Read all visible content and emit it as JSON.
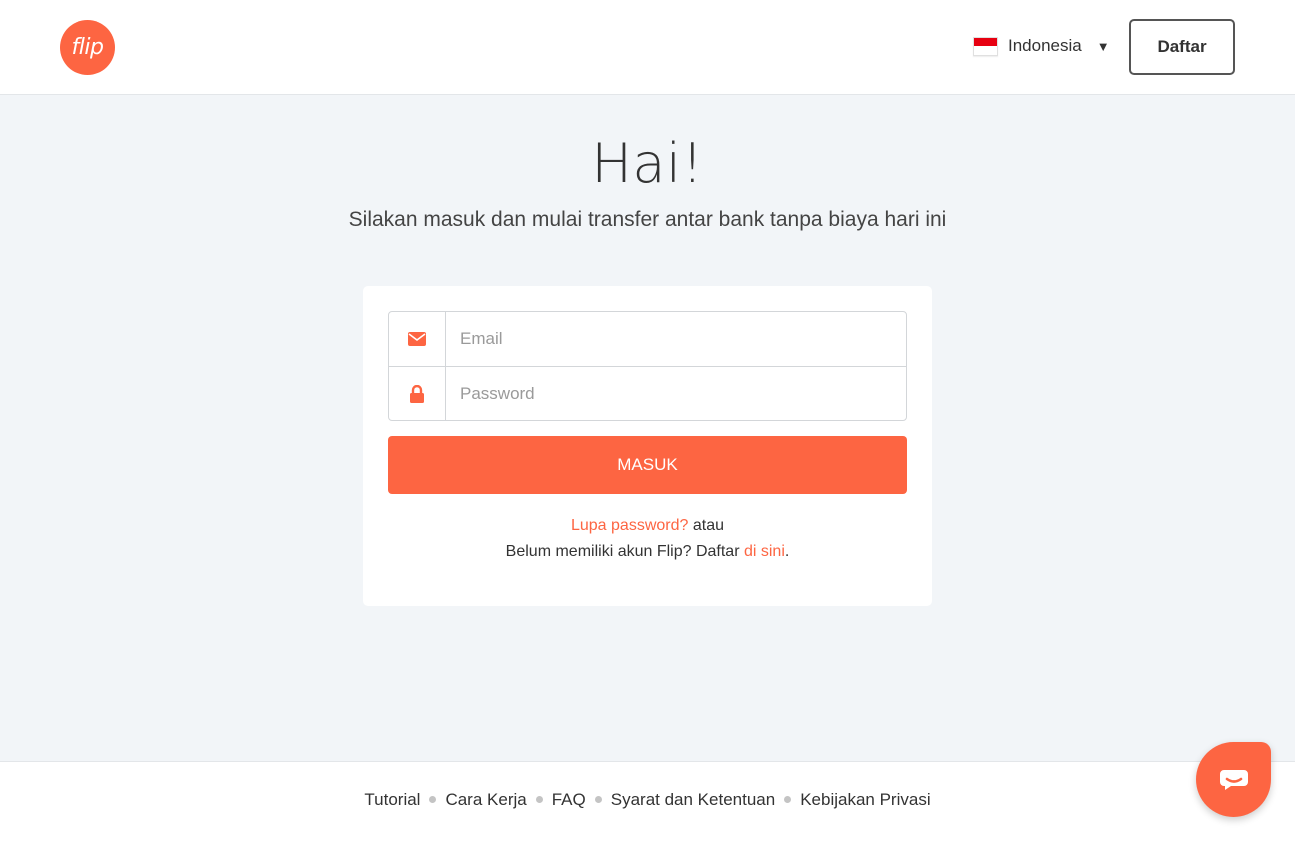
{
  "brand": {
    "logo_text": "flip",
    "accent_color": "#fd6542"
  },
  "header": {
    "language": {
      "label": "Indonesia",
      "flag": "indonesia-flag-icon",
      "caret": "▼"
    },
    "register_button": "Daftar"
  },
  "hero": {
    "title": "Hai!",
    "subtitle": "Silakan masuk dan mulai transfer antar bank tanpa biaya hari ini"
  },
  "login_form": {
    "email": {
      "placeholder": "Email",
      "icon": "envelope-icon"
    },
    "password": {
      "placeholder": "Password",
      "icon": "lock-icon"
    },
    "submit_label": "MASUK",
    "forgot_password": "Lupa password?",
    "or_text": " atau",
    "signup_prefix": "Belum memiliki akun Flip? Daftar ",
    "signup_link": "di sini",
    "signup_suffix": "."
  },
  "footer": {
    "links": [
      "Tutorial",
      "Cara Kerja",
      "FAQ",
      "Syarat dan Ketentuan",
      "Kebijakan Privasi"
    ]
  },
  "chat_widget": {
    "icon": "chat-bubble-icon"
  }
}
